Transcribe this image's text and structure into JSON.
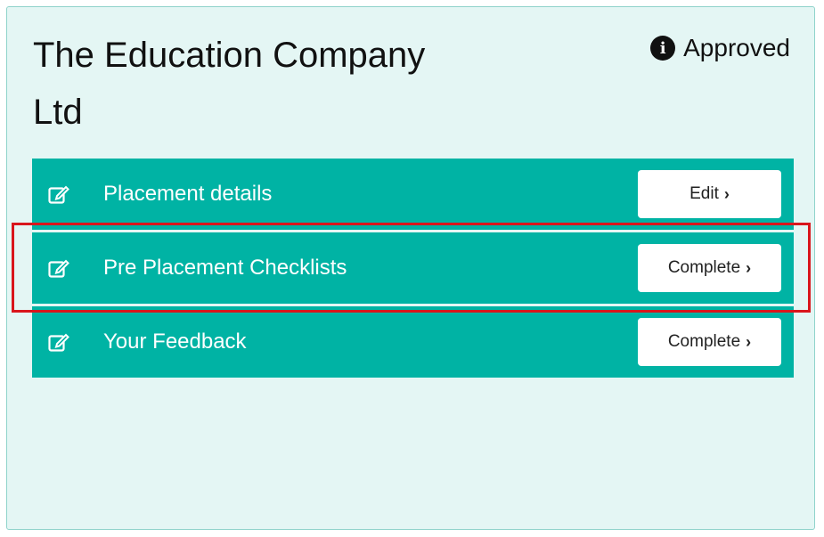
{
  "header": {
    "company_name": "The Education Company Ltd",
    "status_label": "Approved",
    "status_icon": "info-icon"
  },
  "sections": [
    {
      "label": "Placement details",
      "action_label": "Edit",
      "icon": "edit-icon"
    },
    {
      "label": "Pre Placement Checklists",
      "action_label": "Complete",
      "icon": "edit-icon",
      "highlighted": true
    },
    {
      "label": "Your Feedback",
      "action_label": "Complete",
      "icon": "edit-icon"
    }
  ],
  "colors": {
    "card_background": "#e4f6f4",
    "row_background": "#00b3a4",
    "highlight_border": "#d9161c"
  }
}
